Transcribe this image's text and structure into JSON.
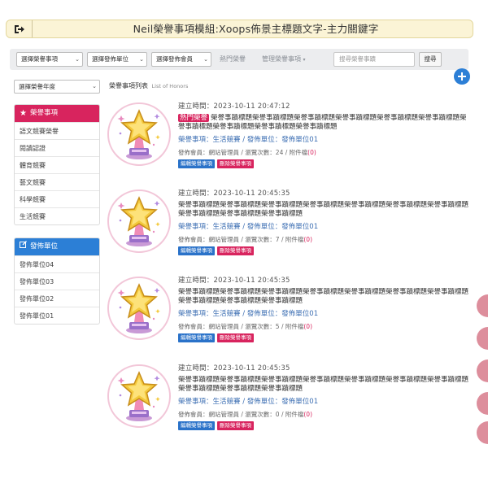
{
  "header": {
    "title": "Neil榮譽事項模組:Xoops佈景主標題文字-主力關鍵字",
    "exit_icon": "exit-icon"
  },
  "searchbar": {
    "select_item": "選擇榮譽事項",
    "select_unit": "選擇發佈單位",
    "select_member": "選擇發佈會員",
    "nav_hot": "熱門榮譽",
    "nav_manage": "管理榮譽事項",
    "search_placeholder": "搜尋榮譽事蹟",
    "search_button": "搜尋"
  },
  "sidebar": {
    "year_select": "選擇榮譽年度",
    "items_box": {
      "title": "榮譽事項",
      "color": "#d8245e",
      "items": [
        "語文競賽榮譽",
        "閱讀認證",
        "體育競賽",
        "藝文競賽",
        "科學競賽",
        "生活競賽"
      ]
    },
    "units_box": {
      "title": "發佈單位",
      "color": "#2c7fd6",
      "items": [
        "發佈單位04",
        "發佈單位03",
        "發佈單位02",
        "發佈單位01"
      ]
    }
  },
  "main": {
    "list_title": "榮譽事項列表",
    "list_title_en": "List of Honors",
    "honors": [
      {
        "date": "建立時間：2023-10-11 20:47:12",
        "hot_badge": "熱門榮譽",
        "headline": "榮譽事蹟標題榮譽事蹟標題榮譽事蹟標題榮譽事蹟標題榮譽事蹟標題榮譽事蹟標題榮譽事蹟標題榮譽事蹟標題榮譽事蹟標題榮譽事蹟標題",
        "item_label": "榮譽事項：生活競賽",
        "unit_label": "發佈單位：發佈單位01",
        "publisher": "發佈會員：網站管理員",
        "views": "瀏覽次數：24",
        "attach_label": "附件檔",
        "attach_count": "(0)",
        "edit": "編輯榮譽事項",
        "delete": "刪除榮譽事項"
      },
      {
        "date": "建立時間：2023-10-11 20:45:35",
        "hot_badge": "",
        "headline": "榮譽事蹟標題榮譽事蹟標題榮譽事蹟標題榮譽事蹟標題榮譽事蹟標題榮譽事蹟標題榮譽事蹟標題榮譽事蹟標題榮譽事蹟標題榮譽事蹟標題",
        "item_label": "榮譽事項：生活競賽",
        "unit_label": "發佈單位：發佈單位01",
        "publisher": "發佈會員：網站管理員",
        "views": "瀏覽次數：7",
        "attach_label": "附件檔",
        "attach_count": "(0)",
        "edit": "編輯榮譽事項",
        "delete": "刪除榮譽事項"
      },
      {
        "date": "建立時間：2023-10-11 20:45:35",
        "hot_badge": "",
        "headline": "榮譽事蹟標題榮譽事蹟標題榮譽事蹟標題榮譽事蹟標題榮譽事蹟標題榮譽事蹟標題榮譽事蹟標題榮譽事蹟標題榮譽事蹟標題榮譽事蹟標題",
        "item_label": "榮譽事項：生活競賽",
        "unit_label": "發佈單位：發佈單位01",
        "publisher": "發佈會員：網站管理員",
        "views": "瀏覽次數：5",
        "attach_label": "附件檔",
        "attach_count": "(0)",
        "edit": "編輯榮譽事項",
        "delete": "刪除榮譽事項"
      },
      {
        "date": "建立時間：2023-10-11 20:45:35",
        "hot_badge": "",
        "headline": "榮譽事蹟標題榮譽事蹟標題榮譽事蹟標題榮譽事蹟標題榮譽事蹟標題榮譽事蹟標題榮譽事蹟標題榮譽事蹟標題榮譽事蹟標題榮譽事蹟標題",
        "item_label": "榮譽事項：生活競賽",
        "unit_label": "發佈單位：發佈單位01",
        "publisher": "發佈會員：網站管理員",
        "views": "瀏覽次數：0",
        "attach_label": "附件檔",
        "attach_count": "(0)",
        "edit": "編輯榮譽事項",
        "delete": "刪除榮譽事項"
      }
    ]
  },
  "colors": {
    "accent_pink": "#d8245e",
    "accent_blue": "#2c7fd6",
    "banner_bg": "#fbf4d6"
  }
}
